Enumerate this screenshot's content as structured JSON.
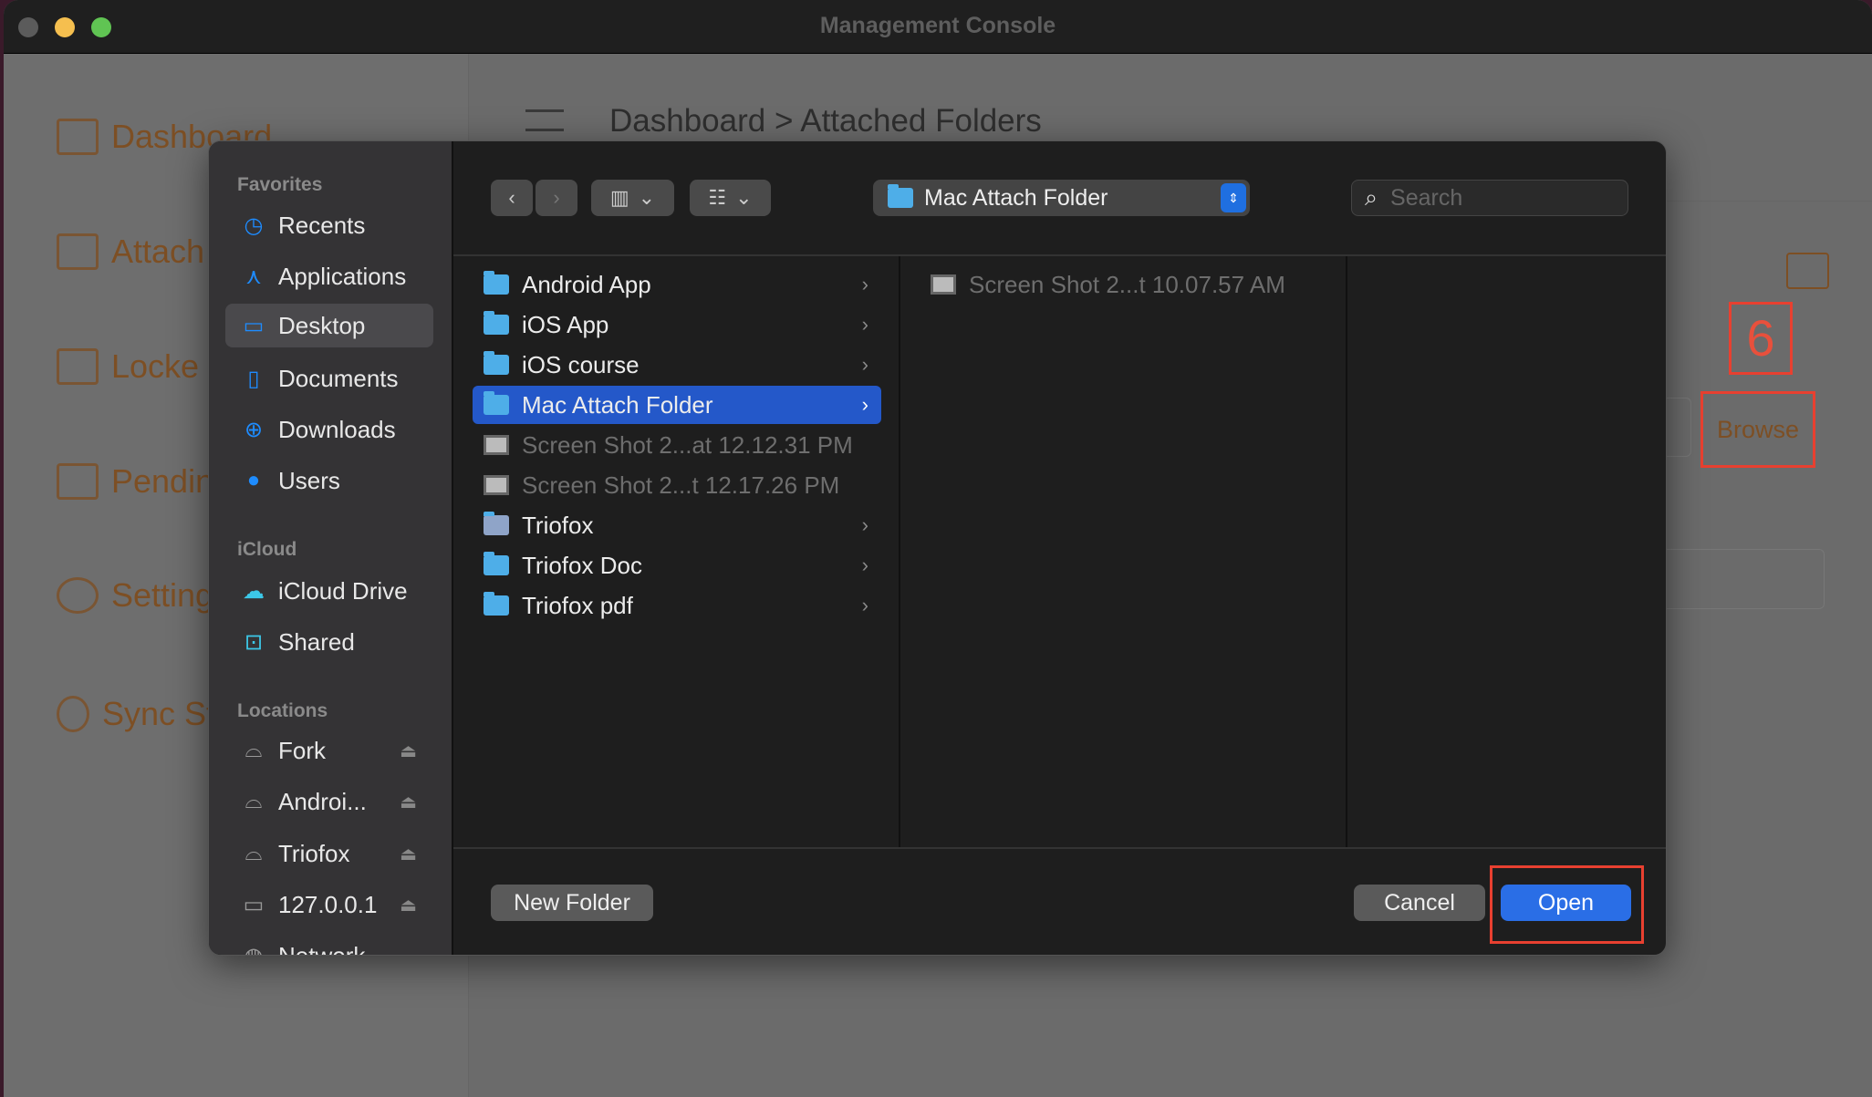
{
  "window": {
    "title": "Management Console"
  },
  "background": {
    "nav": [
      {
        "label": "Dashboard",
        "icon": "house-icon"
      },
      {
        "label": "Attach",
        "icon": "attach-icon"
      },
      {
        "label": "Locke",
        "icon": "lock-icon"
      },
      {
        "label": "Pendin",
        "icon": "pending-icon"
      },
      {
        "label": "Setting",
        "icon": "gear-icon"
      },
      {
        "label": "Sync St",
        "icon": "sync-icon"
      }
    ],
    "breadcrumb": {
      "root": "Dashboard",
      "separator": ">",
      "current": "Attached Folders"
    },
    "step_label": "6",
    "browse_label": "Browse"
  },
  "dialog": {
    "sidebar": {
      "favorites_header": "Favorites",
      "favorites": [
        {
          "label": "Recents",
          "icon": "clock-icon"
        },
        {
          "label": "Applications",
          "icon": "applications-icon"
        },
        {
          "label": "Desktop",
          "icon": "desktop-icon",
          "selected": true
        },
        {
          "label": "Documents",
          "icon": "document-icon"
        },
        {
          "label": "Downloads",
          "icon": "download-icon"
        },
        {
          "label": "Users",
          "icon": "user-icon"
        }
      ],
      "icloud_header": "iCloud",
      "icloud": [
        {
          "label": "iCloud Drive",
          "icon": "cloud-icon"
        },
        {
          "label": "Shared",
          "icon": "shared-folder-icon"
        }
      ],
      "locations_header": "Locations",
      "locations": [
        {
          "label": "Fork",
          "icon": "drive-icon"
        },
        {
          "label": "Androi...",
          "icon": "drive-icon"
        },
        {
          "label": "Triofox",
          "icon": "drive-icon"
        },
        {
          "label": "127.0.0.1",
          "icon": "monitor-icon"
        },
        {
          "label": "Network",
          "icon": "globe-icon"
        }
      ]
    },
    "toolbar": {
      "path": "Mac Attach Folder",
      "search_placeholder": "Search"
    },
    "column1": [
      {
        "name": "Android App",
        "type": "folder"
      },
      {
        "name": "iOS App",
        "type": "folder"
      },
      {
        "name": "iOS course",
        "type": "folder"
      },
      {
        "name": "Mac Attach Folder",
        "type": "folder",
        "selected": true
      },
      {
        "name": "Screen Shot 2...at 12.12.31 PM",
        "type": "file"
      },
      {
        "name": "Screen Shot 2...t 12.17.26 PM",
        "type": "file"
      },
      {
        "name": "Triofox",
        "type": "alias"
      },
      {
        "name": "Triofox Doc",
        "type": "folder"
      },
      {
        "name": "Triofox pdf",
        "type": "folder"
      }
    ],
    "column2": [
      {
        "name": "Screen Shot 2...t 10.07.57 AM",
        "type": "file"
      }
    ],
    "buttons": {
      "new_folder": "New Folder",
      "cancel": "Cancel",
      "open": "Open"
    }
  },
  "colors": {
    "accent": "#2458c9",
    "annotation": "#e84030",
    "brand": "#7d4f24"
  }
}
